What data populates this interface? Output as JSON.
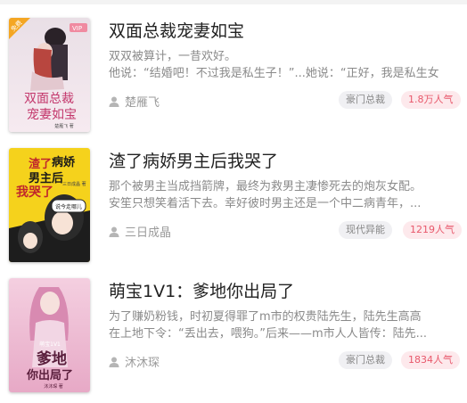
{
  "books": [
    {
      "title": "双面总裁宠妻如宝",
      "desc_line1": "双双被算计，一昔欢好。",
      "desc_line2": "他说：“结婚吧！不过我是私生子！”...她说：“正好，我是私生女",
      "author": "楚雁飞",
      "category": "豪门总裁",
      "popularity": "1.8万人气",
      "cover": {
        "badge_free": "免费",
        "badge_vip": "VIP",
        "title_line1": "双面总裁",
        "title_line2": "宠妻如宝",
        "author_small": "楚雁飞 著"
      }
    },
    {
      "title": "渣了病娇男主后我哭了",
      "desc_line1": "那个被男主当成挡箭牌，最终为救男主凄惨死去的炮灰女配。",
      "desc_line2": "安笙只想笑着活下去。幸好彼时男主还是一个中二病青年，...",
      "author": "三日成晶",
      "category": "现代异能",
      "popularity": "1219人气",
      "cover": {
        "title_chars": [
          "渣了",
          "病娇",
          "男主后",
          "我哭了"
        ],
        "bubble": "说今走哪儿",
        "small_text": "三日成晶 著"
      }
    },
    {
      "title": "萌宝1V1：爹地你出局了",
      "desc_line1": "为了赚奶粉钱，时初夏得罪了m市的权贵陆先生，陆先生高高",
      "desc_line2": "在上地下令：“丢出去，喂狗。”后来——m市人人皆传：陆先...",
      "author": "沐沐琛",
      "category": "豪门总裁",
      "popularity": "1834人气",
      "cover": {
        "small_top": "萌宝1V1",
        "title_line1": "爹地",
        "title_line2": "你出局了",
        "author_small": "沐沐琛 著"
      }
    }
  ]
}
